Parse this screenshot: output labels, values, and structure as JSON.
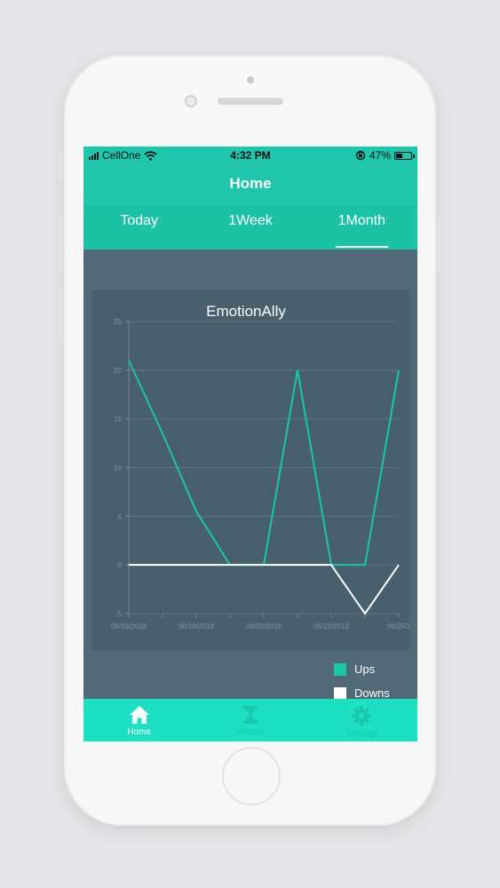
{
  "status_bar": {
    "carrier": "CellOne",
    "time": "4:32 PM",
    "battery_percent": "47%",
    "battery_level": 0.47,
    "icons": [
      "signal-icon",
      "wifi-icon",
      "orientation-lock-icon",
      "battery-icon"
    ]
  },
  "nav_bar": {
    "title": "Home"
  },
  "tabs": [
    {
      "label": "Today",
      "active": false
    },
    {
      "label": "1Week",
      "active": false
    },
    {
      "label": "1Month",
      "active": true
    }
  ],
  "chart_data": {
    "type": "line",
    "title": "EmotionAlly",
    "xlabel": "",
    "ylabel": "",
    "ylim": [
      -5,
      25
    ],
    "y_ticks": [
      -5,
      0,
      5,
      10,
      15,
      20,
      25
    ],
    "x_ticks": [
      "06/16/2018",
      "06/18/2018",
      "06/20/2018",
      "06/22/2018",
      "06/26/2"
    ],
    "x": [
      0,
      1,
      2,
      3,
      4,
      5,
      6,
      7,
      8
    ],
    "grid": true,
    "legend_position": "bottom-right",
    "series": [
      {
        "name": "Ups",
        "color": "#19c7a6",
        "values": [
          21,
          13.5,
          5.5,
          0,
          0,
          20,
          0,
          0,
          20
        ]
      },
      {
        "name": "Downs",
        "color": "#ffffff",
        "values": [
          0,
          0,
          0,
          0,
          0,
          0,
          0,
          -5,
          0
        ]
      }
    ]
  },
  "legend": {
    "items": [
      {
        "label": "Ups",
        "color": "#19c7a6"
      },
      {
        "label": "Downs",
        "color": "#ffffff"
      }
    ]
  },
  "tab_bar": {
    "items": [
      {
        "label": "Home",
        "icon": "home-icon",
        "active": true
      },
      {
        "label": "History",
        "icon": "hourglass-icon",
        "active": false
      },
      {
        "label": "Settings",
        "icon": "gear-icon",
        "active": false
      }
    ]
  },
  "colors": {
    "accent": "#1fc6ab",
    "background": "#506a78",
    "chart_background": "#485f6d"
  }
}
